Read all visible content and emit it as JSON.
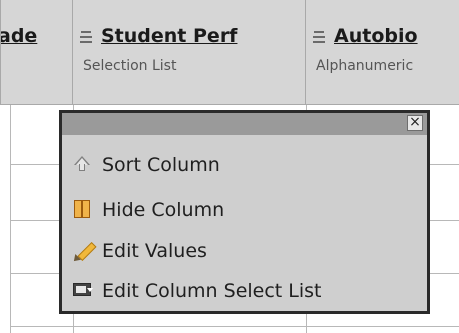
{
  "grid": {
    "columns": [
      {
        "title": "ade",
        "subtitle": "",
        "sortable": false
      },
      {
        "title": "Student Perf",
        "subtitle": "Selection List",
        "sortable": true
      },
      {
        "title": "Autobio",
        "subtitle": "Alphanumeric",
        "sortable": true
      }
    ]
  },
  "context_menu": {
    "close_label": "×",
    "items": [
      {
        "label": "Sort Column",
        "icon": "sort-up-icon"
      },
      {
        "label": "Hide Column",
        "icon": "hide-column-icon"
      },
      {
        "label": "Edit Values",
        "icon": "pencil-icon"
      },
      {
        "label": "Edit Column Select List",
        "icon": "select-list-icon"
      }
    ]
  }
}
